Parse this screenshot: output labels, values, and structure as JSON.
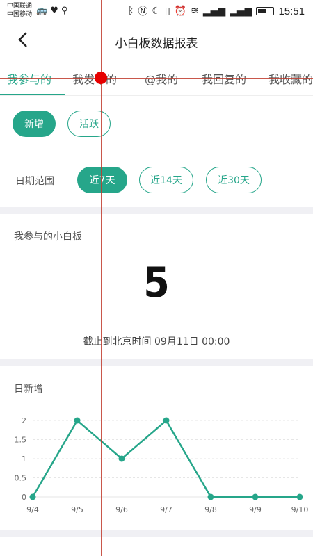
{
  "status_bar": {
    "carrier1": "中国联通",
    "carrier2": "中国移动",
    "time": "15:51"
  },
  "header": {
    "title": "小白板数据报表"
  },
  "tabs": [
    {
      "label": "我参与的",
      "active": true
    },
    {
      "label": "我发布的",
      "active": false
    },
    {
      "label": "@我的",
      "active": false
    },
    {
      "label": "我回复的",
      "active": false
    },
    {
      "label": "我收藏的",
      "active": false
    }
  ],
  "type_filter": {
    "new": "新增",
    "active": "活跃"
  },
  "date_range": {
    "label": "日期范围",
    "opt7": "近7天",
    "opt14": "近14天",
    "opt30": "近30天"
  },
  "summary": {
    "title": "我参与的小白板",
    "value": "5",
    "cutoff": "截止到北京时间 09月11日 00:00"
  },
  "daily": {
    "title": "日新增"
  },
  "colors": {
    "accent": "#26a68a"
  },
  "chart_data": {
    "type": "line",
    "categories": [
      "9/4",
      "9/5",
      "9/6",
      "9/7",
      "9/8",
      "9/9",
      "9/10"
    ],
    "values": [
      0,
      2,
      1,
      2,
      0,
      0,
      0
    ],
    "ylim": [
      0,
      2
    ],
    "yticks": [
      "0",
      "0.5",
      "1",
      "1.5",
      "2"
    ]
  }
}
